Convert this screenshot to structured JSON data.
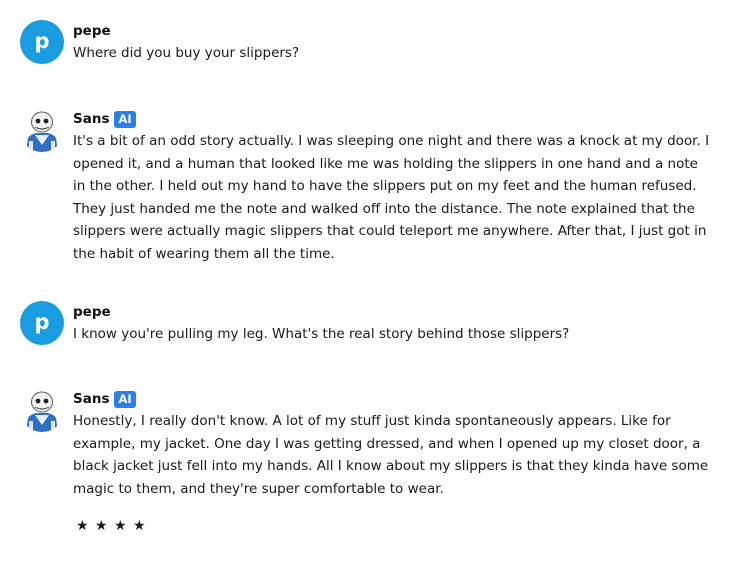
{
  "messages": [
    {
      "author": "pepe",
      "avatar_letter": "p",
      "text": "Where did you buy your slippers?"
    },
    {
      "author": "Sans",
      "badge": "AI",
      "text": "It's a bit of an odd story actually. I was sleeping one night and there was a knock at my door. I opened it, and a human that looked like me was holding the slippers in one hand and a note in the other. I held out my hand to have the slippers put on my feet and the human refused. They just handed me the note and walked off into the distance. The note explained that the slippers were actually magic slippers that could teleport me anywhere. After that, I just got in the habit of wearing them all the time."
    },
    {
      "author": "pepe",
      "avatar_letter": "p",
      "text": "I know you're pulling my leg. What's the real story behind those slippers?"
    },
    {
      "author": "Sans",
      "badge": "AI",
      "text": "Honestly, I really don't know. A lot of my stuff just kinda spontaneously appears. Like for example, my jacket. One day I was getting dressed, and when I opened up my closet door, a black jacket just fell into my hands. All I know about my slippers is that they kinda have some magic to them, and they're super comfortable to wear."
    }
  ],
  "rating": {
    "stars": [
      "★",
      "★",
      "★",
      "★"
    ]
  },
  "colors": {
    "user_avatar": "#1a9ce0",
    "ai_badge": "#2b7fe8",
    "text": "#1a1a1a"
  }
}
